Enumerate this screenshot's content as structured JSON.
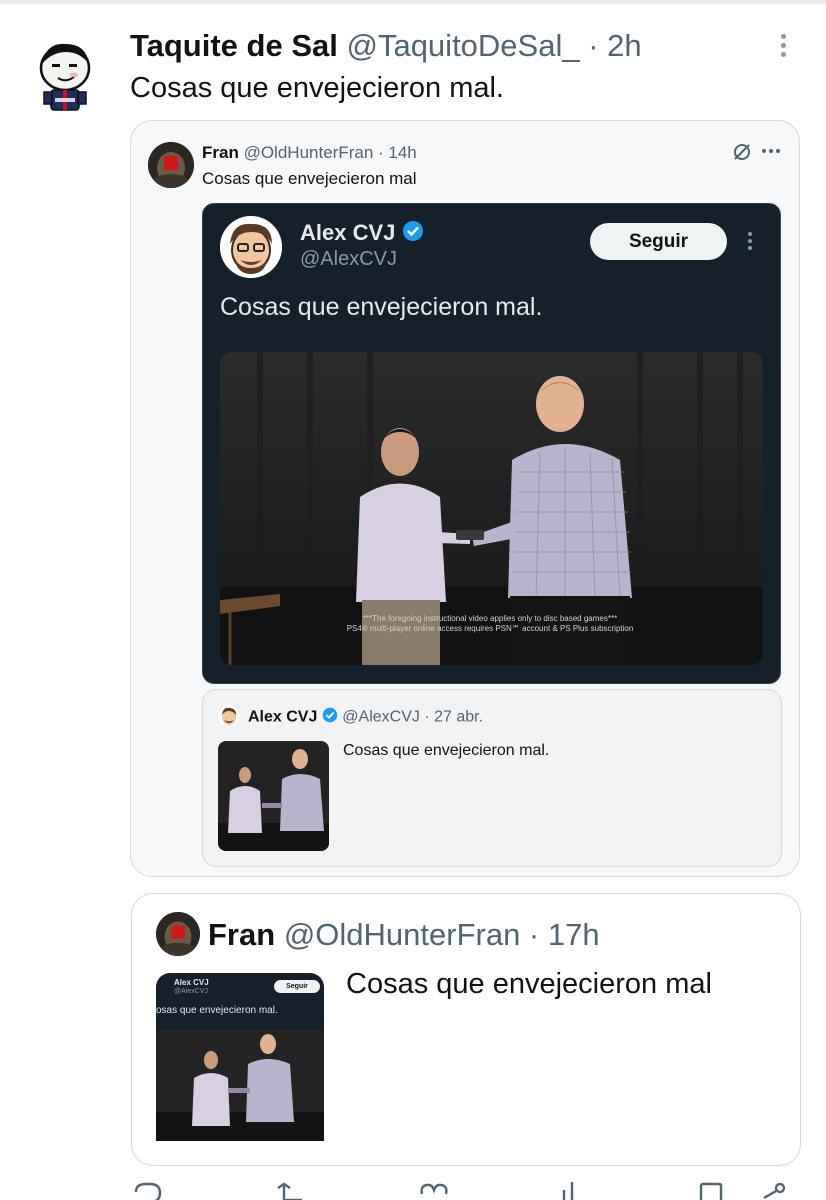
{
  "tweet": {
    "author_name": "Taquite de Sal",
    "author_handle": "@TaquitoDeSal_",
    "separator": " · ",
    "time": "2h",
    "text": "Cosas que envejecieron mal."
  },
  "quote": {
    "author_name": "Fran",
    "author_handle": "@OldHunterFran",
    "separator": " · ",
    "time": "14h",
    "text": "Cosas que envejecieron mal",
    "embedded_screenshot": {
      "author_name": "Alex CVJ",
      "author_handle": "@AlexCVJ",
      "follow_label": "Seguir",
      "text": "Cosas que envejecieron mal.",
      "caption_line1": "***The foregoing instructional video applies only to disc based games***",
      "caption_line2": "PS4® multi-player online access requires PSN℠ account & PS Plus subscription"
    },
    "inner_quote": {
      "author_name": "Alex CVJ",
      "author_handle": "@AlexCVJ",
      "separator": " · ",
      "time": "27 abr.",
      "text": "Cosas que envejecieron mal."
    }
  },
  "quote2": {
    "author_name": "Fran",
    "author_handle": "@OldHunterFran",
    "separator": " · ",
    "time": "17h",
    "text": "Cosas que envejecieron mal",
    "thumb": {
      "author_name": "Alex CVJ",
      "author_handle": "@AlexCVJ",
      "follow_label": "Seguir",
      "text": "osas que envejecieron mal."
    }
  },
  "icons": {
    "verified": "verified-badge-icon",
    "grok": "grok-icon",
    "more": "more-icon",
    "reply": "reply-icon",
    "retweet": "retweet-icon",
    "like": "like-icon",
    "views": "views-icon",
    "bookmark": "bookmark-icon",
    "share": "share-icon"
  },
  "colors": {
    "text_primary": "#0f1419",
    "text_secondary": "#536471",
    "verified_blue": "#1d9bf0",
    "dark_bg": "#15202b"
  }
}
